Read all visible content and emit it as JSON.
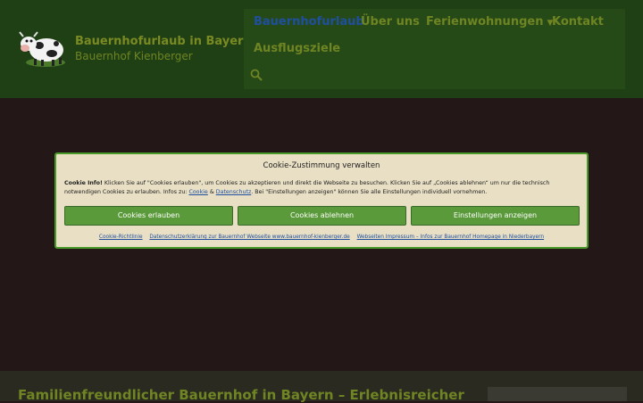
{
  "header": {
    "site_title": "Bauernhofurlaub in Bayern",
    "site_description": "Bauernhof Kienberger"
  },
  "nav": {
    "items": [
      {
        "label": "Bauernhofurlaub"
      },
      {
        "label": "Über uns"
      },
      {
        "label": "Ferienwohnungen"
      },
      {
        "label": "Kontakt"
      },
      {
        "label": "Ausflugsziele"
      }
    ]
  },
  "cookie": {
    "title": "Cookie-Zustimmung verwalten",
    "info_label": "Cookie Info!",
    "text_1": " Klicken Sie auf \"Cookies erlauben\", um Cookies zu akzeptieren und direkt die Webseite zu besuchen. Klicken Sie auf „Cookies ablehnen“ um nur die technisch notwendigen Cookies zu erlauben. Infos zu: ",
    "link_cookie": "Cookie",
    "amp": " & ",
    "link_datenschutz": "Datenschutz",
    "text_2": ". Bei \"Einstellungen anzeigen\" können Sie alle Einstellungen individuell vornehmen.",
    "buttons": {
      "accept": "Cookies erlauben",
      "decline": "Cookies ablehnen",
      "settings": "Einstellungen anzeigen"
    },
    "links": {
      "policy": "Cookie-Richtlinie",
      "privacy": "Datenschutzerklärung zur Bauernhof Webseite www.bauernhof-kienberger.de",
      "imprint": "Webseiten Impressum – Infos zur Bauernhof Homepage in Niederbayern"
    }
  },
  "content": {
    "title": "Familienfreundlicher Bauernhof in Bayern – Erlebnisreicher"
  },
  "colors": {
    "header_bg": "#1f3f15",
    "nav_bg": "#264a17",
    "accent_green": "#5a9a3a",
    "active_blue": "#1f4f9f"
  }
}
